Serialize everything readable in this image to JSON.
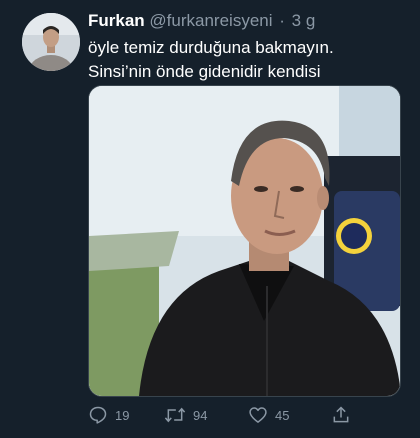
{
  "tweet": {
    "author": {
      "name": "Furkan",
      "handle": "@furkanreisyeni",
      "separator": "·",
      "time": "3 g"
    },
    "text_lines": [
      "öyle temiz durduğuna bakmayın.",
      "Sinsi’nin önde gidenidir kendisi"
    ],
    "media": {
      "icon": "photo-of-man-in-black-jacket"
    },
    "actions": {
      "reply_count": "19",
      "retweet_count": "94",
      "like_count": "45"
    }
  },
  "icons": {
    "reply": "reply-icon",
    "retweet": "retweet-icon",
    "like": "heart-icon",
    "share": "share-icon"
  },
  "colors": {
    "background": "#15202b",
    "primary_text": "#ffffff",
    "secondary_text": "#8b98a5",
    "border": "#38444d"
  }
}
